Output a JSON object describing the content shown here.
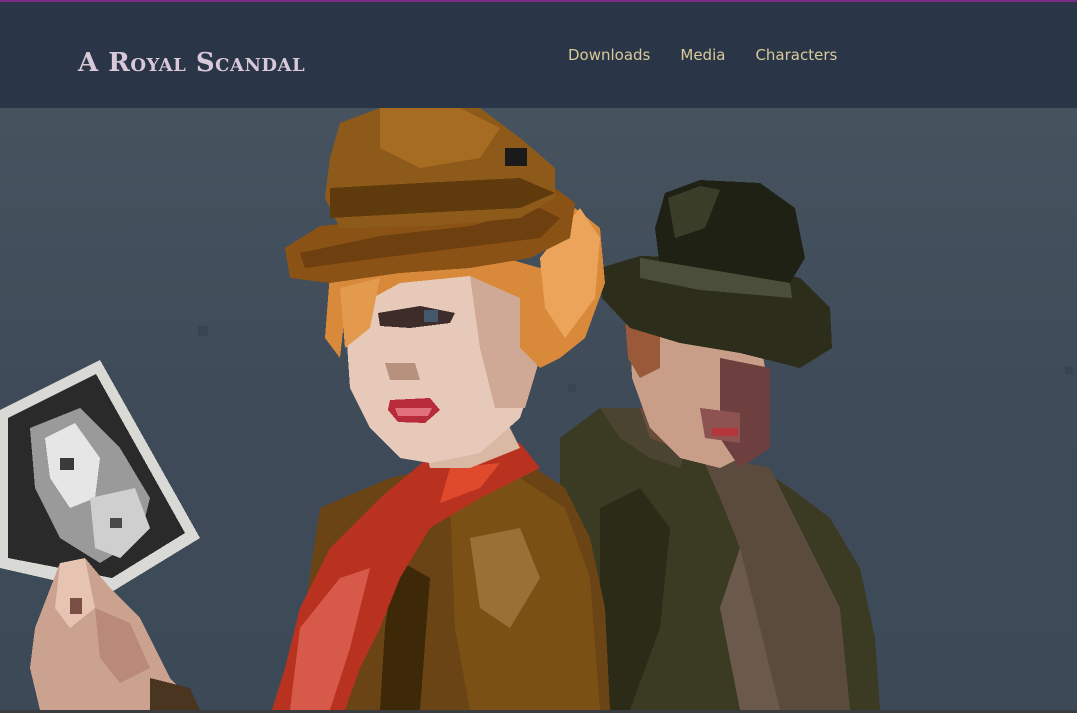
{
  "site": {
    "title": "A Royal Scandal"
  },
  "nav": {
    "items": [
      {
        "label": "Downloads"
      },
      {
        "label": "Media"
      },
      {
        "label": "Characters"
      }
    ]
  },
  "hero": {
    "image": "pixel-art-characters-woman-and-man",
    "colors": {
      "background": "#44505d",
      "header": "#2a3647",
      "nav_text": "#d8c99a",
      "logo_text": "#d9c9d8"
    }
  }
}
